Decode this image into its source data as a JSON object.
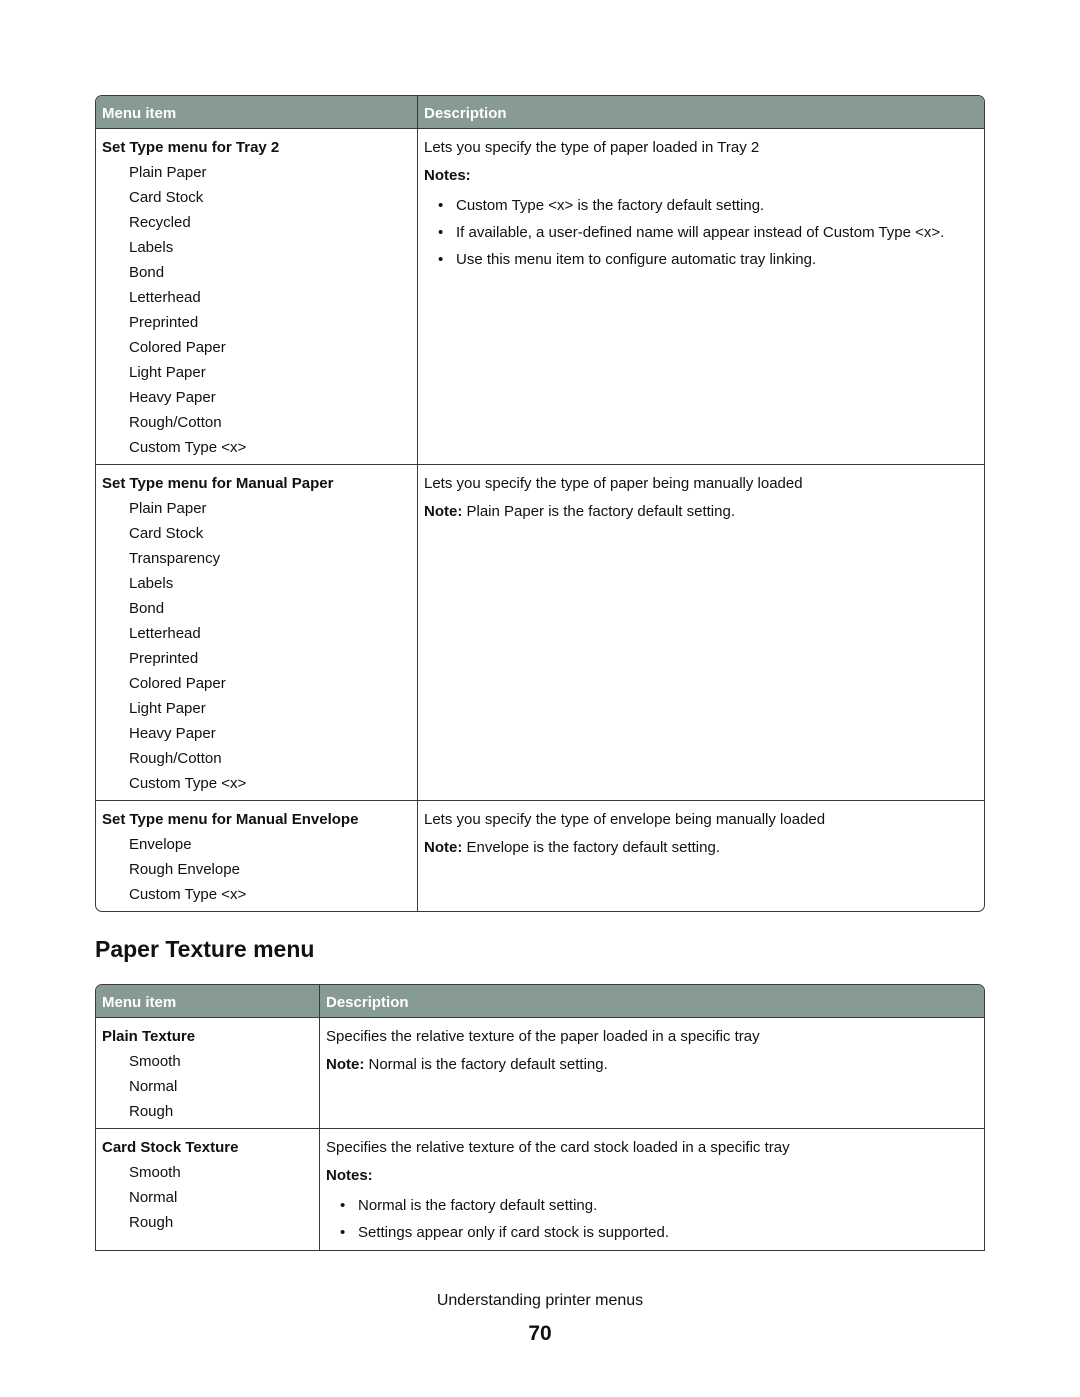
{
  "table1": {
    "headers": {
      "menu_item": "Menu item",
      "description": "Description"
    },
    "rows": [
      {
        "title": "Set Type menu for Tray 2",
        "options": [
          "Plain Paper",
          "Card Stock",
          "Recycled",
          "Labels",
          "Bond",
          "Letterhead",
          "Preprinted",
          "Colored Paper",
          "Light Paper",
          "Heavy Paper",
          "Rough/Cotton",
          "Custom Type <x>"
        ],
        "description": "Lets you specify the type of paper loaded in Tray 2",
        "notes_label": "Notes:",
        "notes": [
          "Custom Type <x> is the factory default setting.",
          "If available, a user-defined name will appear instead of Custom Type <x>.",
          "Use this menu item to configure automatic tray linking."
        ]
      },
      {
        "title": "Set Type menu for Manual Paper",
        "options": [
          "Plain Paper",
          "Card Stock",
          "Transparency",
          "Labels",
          "Bond",
          "Letterhead",
          "Preprinted",
          "Colored Paper",
          "Light Paper",
          "Heavy Paper",
          "Rough/Cotton",
          "Custom Type <x>"
        ],
        "description": "Lets you specify the type of paper being manually loaded",
        "note_label": "Note:",
        "note": "Plain Paper is the factory default setting."
      },
      {
        "title": "Set Type menu for Manual Envelope",
        "options": [
          "Envelope",
          "Rough Envelope",
          "Custom Type <x>"
        ],
        "description": "Lets you specify the type of envelope being manually loaded",
        "note_label": "Note:",
        "note": "Envelope is the factory default setting."
      }
    ]
  },
  "section_title": "Paper Texture menu",
  "table2": {
    "headers": {
      "menu_item": "Menu item",
      "description": "Description"
    },
    "rows": [
      {
        "title": "Plain Texture",
        "options": [
          "Smooth",
          "Normal",
          "Rough"
        ],
        "description": "Specifies the relative texture of the paper loaded in a specific tray",
        "note_label": "Note:",
        "note": "Normal is the factory default setting."
      },
      {
        "title": "Card Stock Texture",
        "options": [
          "Smooth",
          "Normal",
          "Rough"
        ],
        "description": "Specifies the relative texture of the card stock loaded in a specific tray",
        "notes_label": "Notes:",
        "notes": [
          "Normal is the factory default setting.",
          "Settings appear only if card stock is supported."
        ]
      }
    ]
  },
  "footer": {
    "text": "Understanding printer menus",
    "page_number": "70"
  },
  "colors": {
    "header_bg": "#879a96",
    "header_text": "#ffffff",
    "border": "#3a3a3a"
  }
}
